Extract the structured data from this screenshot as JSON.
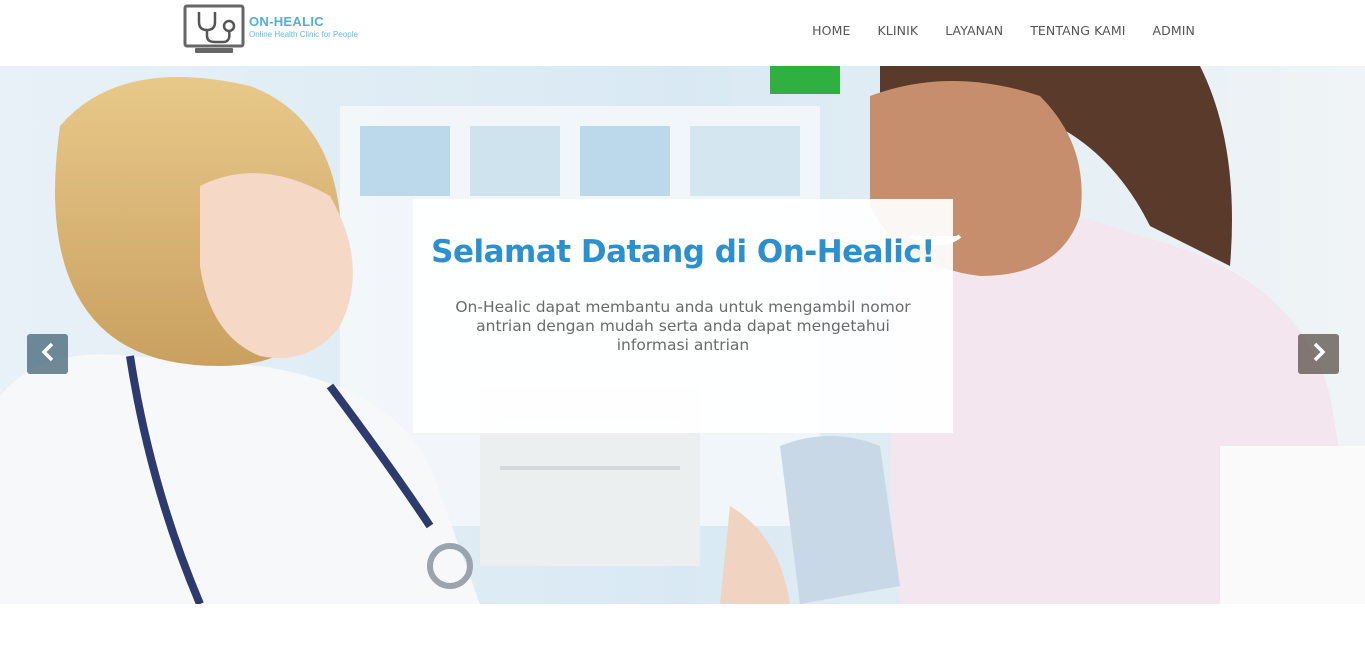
{
  "brand": {
    "name": "ON-HEALIC",
    "tagline": "Online Health Clinic for People"
  },
  "nav": {
    "items": [
      {
        "label": "HOME"
      },
      {
        "label": "KLINIK"
      },
      {
        "label": "LAYANAN"
      },
      {
        "label": "TENTANG KAMI"
      },
      {
        "label": "ADMIN"
      }
    ]
  },
  "hero": {
    "title": "Selamat Datang di On-Healic!",
    "text": "On-Healic dapat membantu anda untuk mengambil nomor antrian dengan mudah serta anda dapat mengetahui informasi antrian",
    "prev_icon": "chevron-left-icon",
    "next_icon": "chevron-right-icon"
  },
  "colors": {
    "accent": "#2e8fcf",
    "brand": "#4fb0d6",
    "nav_text": "#555555"
  }
}
